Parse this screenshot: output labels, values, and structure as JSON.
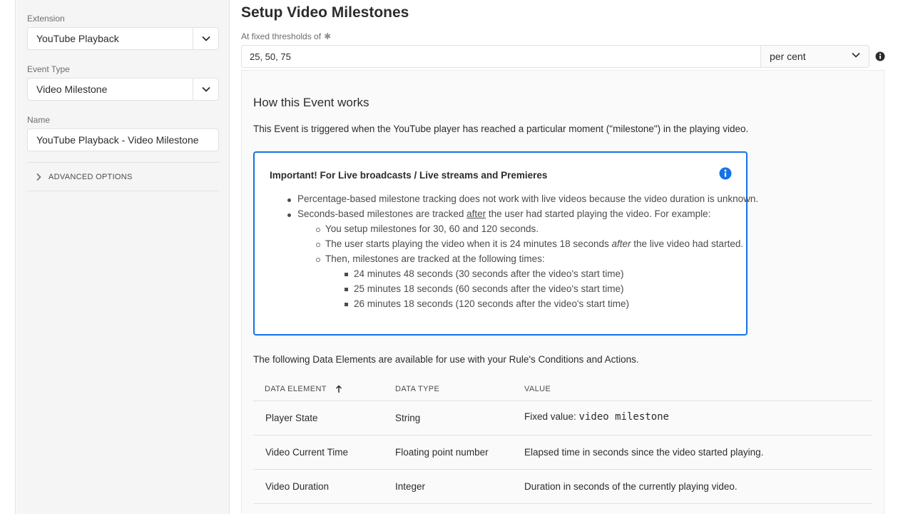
{
  "sidebar": {
    "extension_label": "Extension",
    "extension_value": "YouTube Playback",
    "event_type_label": "Event Type",
    "event_type_value": "Video Milestone",
    "name_label": "Name",
    "name_value": "YouTube Playback - Video Milestone",
    "advanced_options": "ADVANCED OPTIONS"
  },
  "main": {
    "title": "Setup Video Milestones",
    "thresholds_label": "At fixed thresholds of",
    "thresholds_value": "25, 50, 75",
    "unit_value": "per cent",
    "how_title": "How this Event works",
    "how_desc": "This Event is triggered when the YouTube player has reached a particular moment (\"milestone\") in the playing video.",
    "callout": {
      "title": "Important! For Live broadcasts / Live streams and Premieres",
      "b1": "Percentage-based milestone tracking does not work with live videos because the video duration is unknown.",
      "b2_pre": "Seconds-based milestones are tracked ",
      "b2_u": "after",
      "b2_post": " the user had started playing the video. For example:",
      "s1": "You setup milestones for 30, 60 and 120 seconds.",
      "s2_pre": "The user starts playing the video when it is 24 minutes 18 seconds ",
      "s2_i": "after",
      "s2_post": " the live video had started.",
      "s3": "Then, milestones are tracked at the following times:",
      "t1": "24 minutes 48 seconds (30 seconds after the video's start time)",
      "t2": "25 minutes 18 seconds (60 seconds after the video's start time)",
      "t3": "26 minutes 18 seconds (120 seconds after the video's start time)"
    },
    "available_text": "The following Data Elements are available for use with your Rule's Conditions and Actions.",
    "table": {
      "headers": [
        "DATA ELEMENT",
        "DATA TYPE",
        "VALUE"
      ],
      "rows": [
        {
          "element": "Player State",
          "type": "String",
          "value_prefix": "Fixed value: ",
          "value_code": "video milestone"
        },
        {
          "element": "Video Current Time",
          "type": "Floating point number",
          "value": "Elapsed time in seconds since the video started playing."
        },
        {
          "element": "Video Duration",
          "type": "Integer",
          "value": "Duration in seconds of the currently playing video."
        }
      ]
    }
  },
  "colors": {
    "accent": "#1473e6",
    "info_icon": "#1473e6"
  }
}
